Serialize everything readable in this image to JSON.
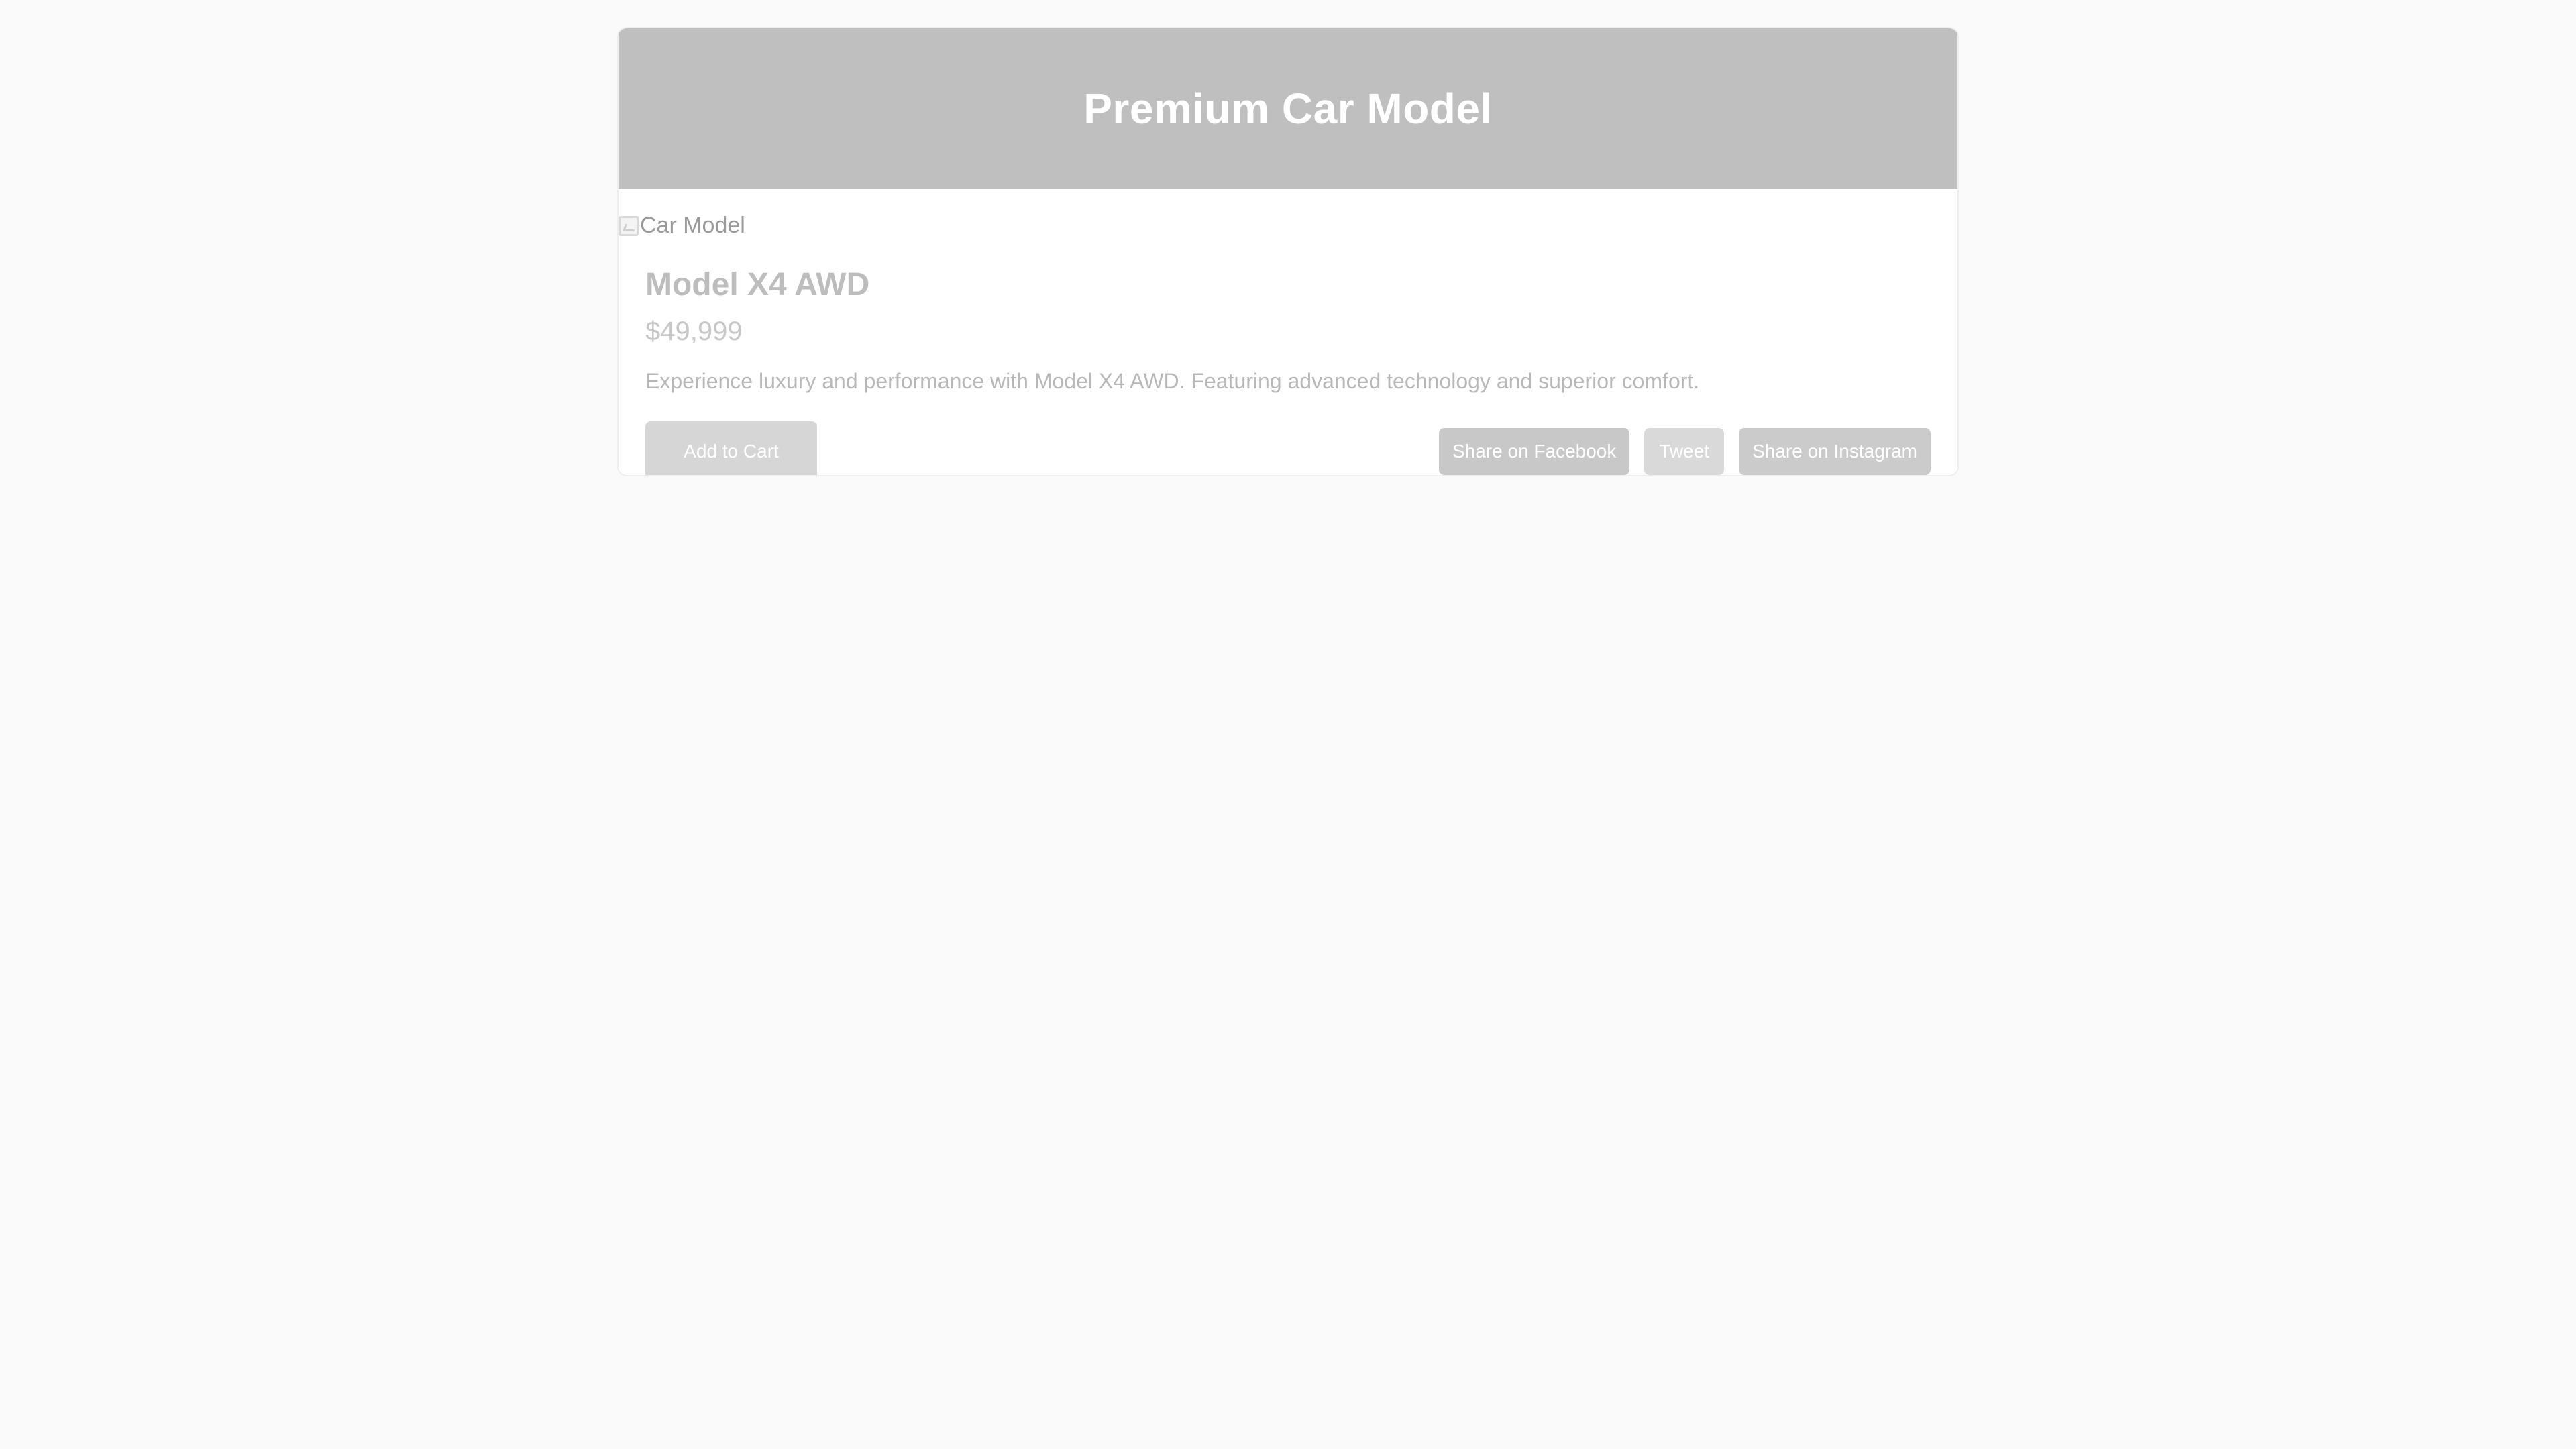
{
  "header": {
    "title": "Premium Car Model"
  },
  "image": {
    "alt": "Car Model"
  },
  "product": {
    "name": "Model X4 AWD",
    "price": "$49,999",
    "description": "Experience luxury and performance with Model X4 AWD. Featuring advanced technology and superior comfort."
  },
  "actions": {
    "add_to_cart": "Add to Cart"
  },
  "share": {
    "facebook": "Share on Facebook",
    "twitter": "Tweet",
    "instagram": "Share on Instagram"
  },
  "colors": {
    "header_bg": "#bfbfbf",
    "page_bg": "#fafafa",
    "button_bg": "#d6d6d6"
  }
}
